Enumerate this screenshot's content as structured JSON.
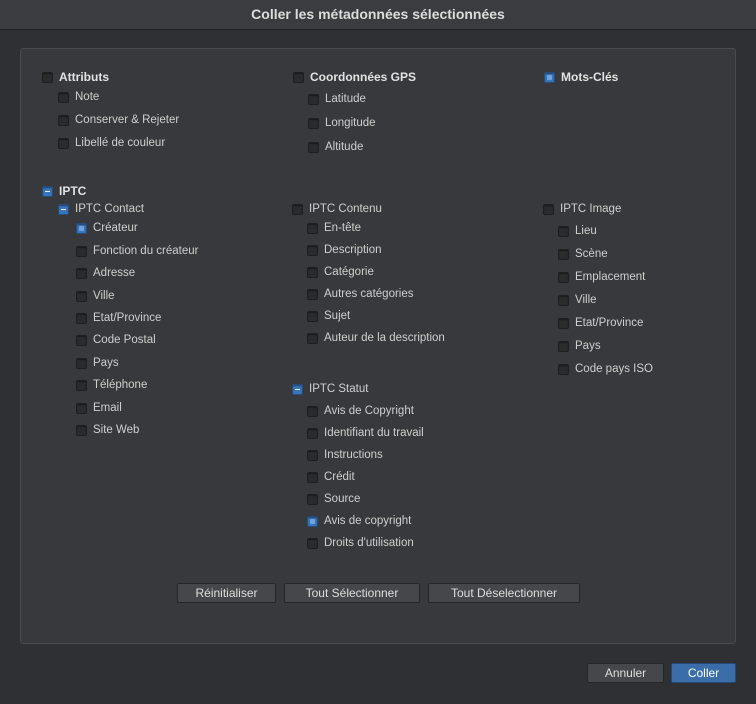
{
  "window": {
    "title": "Coller les métadonnées sélectionnées"
  },
  "attributs": {
    "label": "Attributs",
    "items": [
      "Note",
      "Conserver & Rejeter",
      "Libellé de couleur"
    ]
  },
  "gps": {
    "label": "Coordonnées GPS",
    "items": [
      "Latitude",
      "Longitude",
      "Altitude"
    ]
  },
  "motscles": {
    "label": "Mots-Clés"
  },
  "iptc": {
    "label": "IPTC",
    "contact": {
      "label": "IPTC Contact",
      "items": [
        "Créateur",
        "Fonction du créateur",
        "Adresse",
        "Ville",
        "Etat/Province",
        "Code Postal",
        "Pays",
        "Téléphone",
        "Email",
        "Site Web"
      ]
    },
    "contenu": {
      "label": "IPTC Contenu",
      "items": [
        "En-tête",
        "Description",
        "Catégorie",
        "Autres catégories",
        "Sujet",
        "Auteur de la description"
      ]
    },
    "statut": {
      "label": "IPTC Statut",
      "items": [
        "Avis de Copyright",
        "Identifiant du travail",
        "Instructions",
        "Crédit",
        "Source",
        "Avis de copyright",
        "Droits d'utilisation"
      ]
    },
    "image": {
      "label": "IPTC Image",
      "items": [
        "Lieu",
        "Scène",
        "Emplacement",
        "Ville",
        "Etat/Province",
        "Pays",
        "Code pays ISO"
      ]
    }
  },
  "buttons": {
    "reset": "Réinitialiser",
    "select_all": "Tout Sélectionner",
    "deselect_all": "Tout Déselectionner",
    "cancel": "Annuler",
    "paste": "Coller"
  },
  "colors": {
    "accent": "#3b6ea8",
    "background": "#2f3033",
    "panel": "#38393c"
  }
}
